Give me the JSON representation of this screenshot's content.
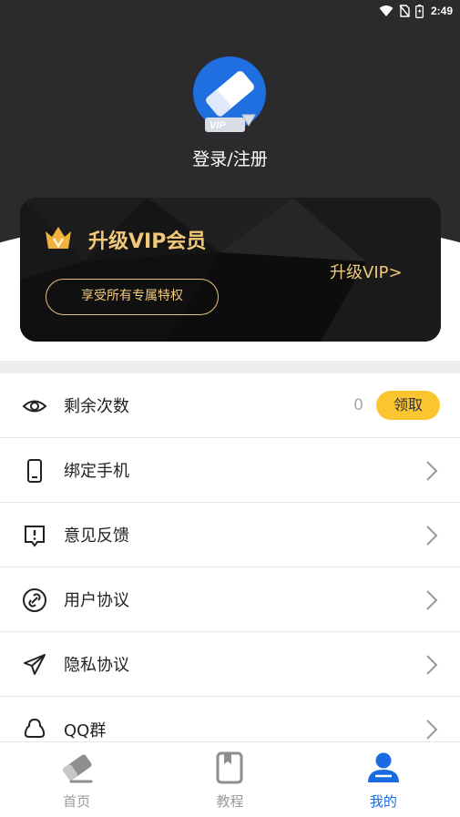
{
  "status_bar": {
    "time": "2:49",
    "icons": [
      "wifi-icon",
      "no-sim-icon",
      "battery-icon"
    ]
  },
  "profile": {
    "login_label": "登录/注册",
    "avatar_badge": "VIP"
  },
  "vip_card": {
    "title": "升级VIP会员",
    "subtitle": "享受所有专属特权",
    "upgrade_label": "升级VIP>",
    "accent_color": "#f2c97a"
  },
  "menu": {
    "remaining": {
      "label": "剩余次数",
      "count": "0",
      "claim_label": "领取",
      "icon": "eye-icon"
    },
    "items": [
      {
        "label": "绑定手机",
        "icon": "phone-icon"
      },
      {
        "label": "意见反馈",
        "icon": "feedback-icon"
      },
      {
        "label": "用户协议",
        "icon": "link-icon"
      },
      {
        "label": "隐私协议",
        "icon": "send-icon"
      },
      {
        "label": "QQ群",
        "icon": "qq-icon"
      }
    ]
  },
  "tabbar": {
    "tabs": [
      {
        "label": "首页",
        "icon": "eraser-icon",
        "active": false
      },
      {
        "label": "教程",
        "icon": "book-icon",
        "active": false
      },
      {
        "label": "我的",
        "icon": "user-icon",
        "active": true
      }
    ],
    "active_color": "#1a6be3"
  }
}
